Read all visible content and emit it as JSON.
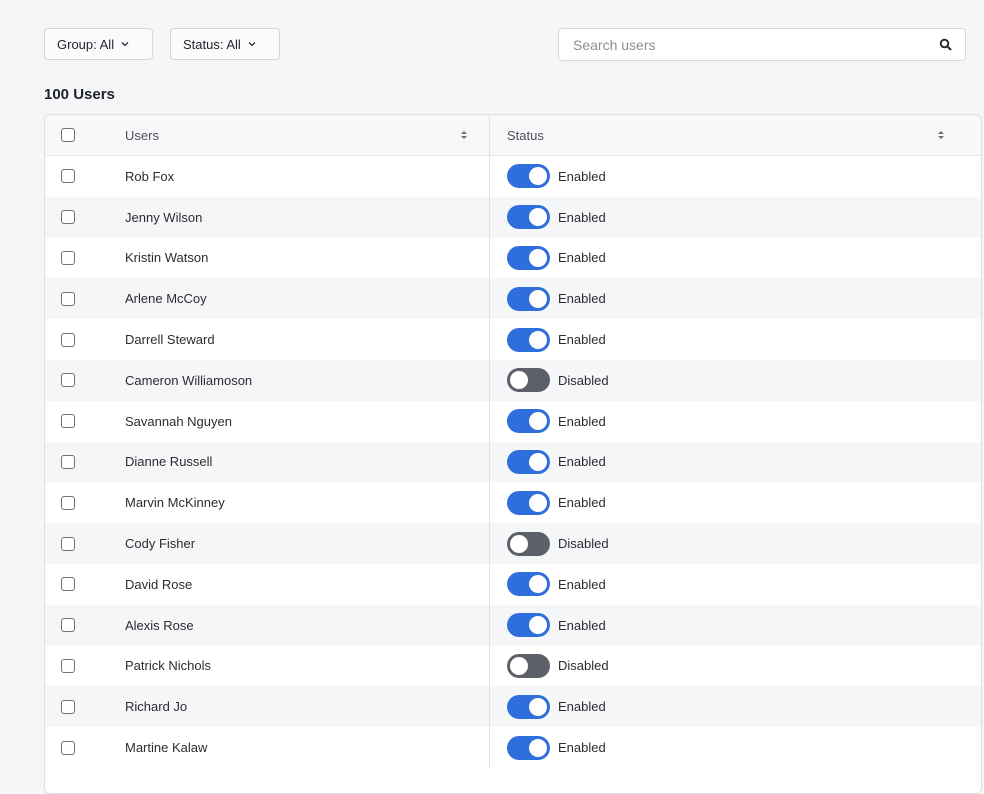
{
  "filters": {
    "group_label": "Group: All",
    "status_label": "Status: All"
  },
  "search": {
    "placeholder": "Search users",
    "value": ""
  },
  "user_count": "100 Users",
  "table": {
    "headers": {
      "users": "Users",
      "status": "Status"
    },
    "rows": [
      {
        "name": "Rob Fox",
        "enabled": true,
        "status": "Enabled"
      },
      {
        "name": "Jenny Wilson",
        "enabled": true,
        "status": "Enabled"
      },
      {
        "name": "Kristin Watson",
        "enabled": true,
        "status": "Enabled"
      },
      {
        "name": "Arlene McCoy",
        "enabled": true,
        "status": "Enabled"
      },
      {
        "name": "Darrell Steward",
        "enabled": true,
        "status": "Enabled"
      },
      {
        "name": "Cameron Williamoson",
        "enabled": false,
        "status": "Disabled"
      },
      {
        "name": "Savannah Nguyen",
        "enabled": true,
        "status": "Enabled"
      },
      {
        "name": "Dianne Russell",
        "enabled": true,
        "status": "Enabled"
      },
      {
        "name": "Marvin McKinney",
        "enabled": true,
        "status": "Enabled"
      },
      {
        "name": "Cody Fisher",
        "enabled": false,
        "status": "Disabled"
      },
      {
        "name": "David Rose",
        "enabled": true,
        "status": "Enabled"
      },
      {
        "name": "Alexis Rose",
        "enabled": true,
        "status": "Enabled"
      },
      {
        "name": "Patrick Nichols",
        "enabled": false,
        "status": "Disabled"
      },
      {
        "name": "Richard Jo",
        "enabled": true,
        "status": "Enabled"
      },
      {
        "name": "Martine Kalaw",
        "enabled": true,
        "status": "Enabled"
      }
    ]
  },
  "colors": {
    "toggle_on": "#2f6fdc",
    "toggle_off": "#5d6068"
  },
  "icons": {
    "filter_chevron": "chevron-down-icon",
    "search": "search-icon",
    "sort": "sort-icon"
  }
}
